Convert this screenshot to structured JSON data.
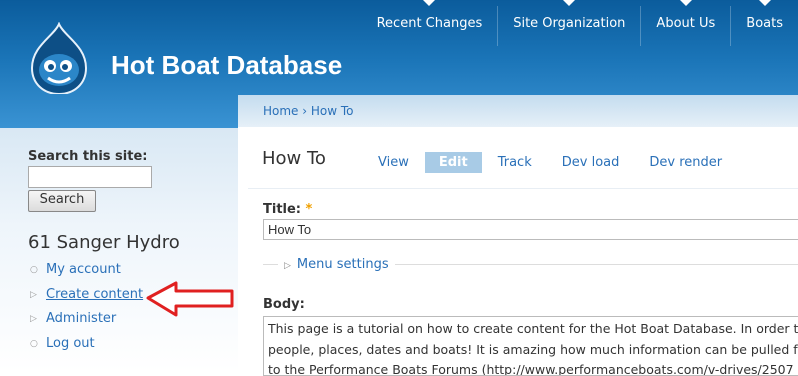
{
  "header": {
    "site_name": "Hot Boat Database",
    "nav": [
      "Recent Changes",
      "Site Organization",
      "About Us",
      "Boats"
    ]
  },
  "sidebar": {
    "search_label": "Search this site:",
    "search_value": "",
    "search_button": "Search",
    "user_name": "61 Sanger Hydro",
    "links": [
      "My account",
      "Create content",
      "Administer",
      "Log out"
    ]
  },
  "content": {
    "breadcrumb": "Home › How To",
    "page_title": "How To",
    "tabs": [
      "View",
      "Edit",
      "Track",
      "Dev load",
      "Dev render"
    ],
    "title_label": "Title:",
    "required_mark": "*",
    "title_value": "How To",
    "menu_settings": "Menu settings",
    "body_label": "Body:",
    "body_lines": [
      "This page is a tutorial on how to create content for the Hot Boat Database. In order to",
      "people, places, dates and boats! It is amazing how much information can be pulled from",
      "to the Performance Boats Forums (http://www.performanceboats.com/v-drives/2507"
    ]
  },
  "colors": {
    "header_blue": "#1a74b7",
    "link_blue": "#2a70b8",
    "arrow_red": "#e02020",
    "active_tab": "#a8cbe6"
  }
}
